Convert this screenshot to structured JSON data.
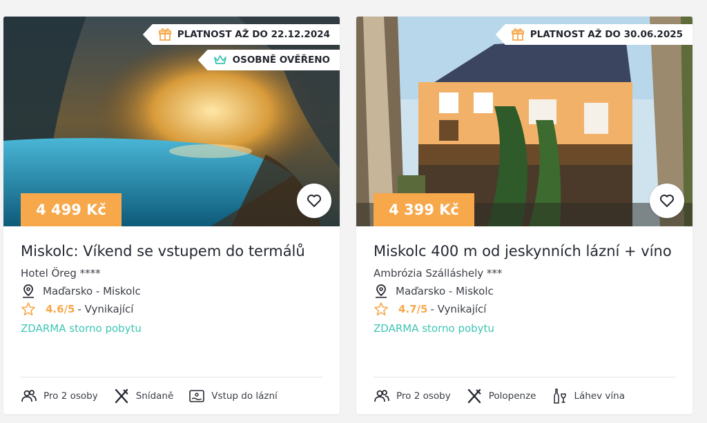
{
  "colors": {
    "price_bg": "#f6a84b",
    "storno": "#3fc5b4",
    "rating": "#f6a84b"
  },
  "cards": [
    {
      "validity": "PLATNOST AŽ DO 22.12.2024",
      "verified": "OSOBNĚ OVĚŘENO",
      "price": "4 499 Kč",
      "title": "Miskolc: Víkend se vstupem do termálů",
      "hotel": "Hotel Öreg ****",
      "location": "Maďarsko - Miskolc",
      "rating": "4.6/5",
      "rating_text": "- Vynikající",
      "storno": "ZDARMA storno pobytu",
      "features": [
        {
          "icon": "people-icon",
          "label": "Pro 2 osoby"
        },
        {
          "icon": "cutlery-icon",
          "label": "Snídaně"
        },
        {
          "icon": "spa-entry-icon",
          "label": "Vstup do lázní"
        }
      ]
    },
    {
      "validity": "PLATNOST AŽ DO 30.06.2025",
      "price": "4 399 Kč",
      "title": "Miskolc 400 m od jeskynních lázní + víno",
      "hotel": "Ambrózia Szálláshely ***",
      "location": "Maďarsko - Miskolc",
      "rating": "4.7/5",
      "rating_text": "- Vynikající",
      "storno": "ZDARMA storno pobytu",
      "features": [
        {
          "icon": "people-icon",
          "label": "Pro 2 osoby"
        },
        {
          "icon": "cutlery-icon",
          "label": "Polopenze"
        },
        {
          "icon": "wine-bottle-icon",
          "label": "Láhev vína"
        }
      ]
    }
  ]
}
